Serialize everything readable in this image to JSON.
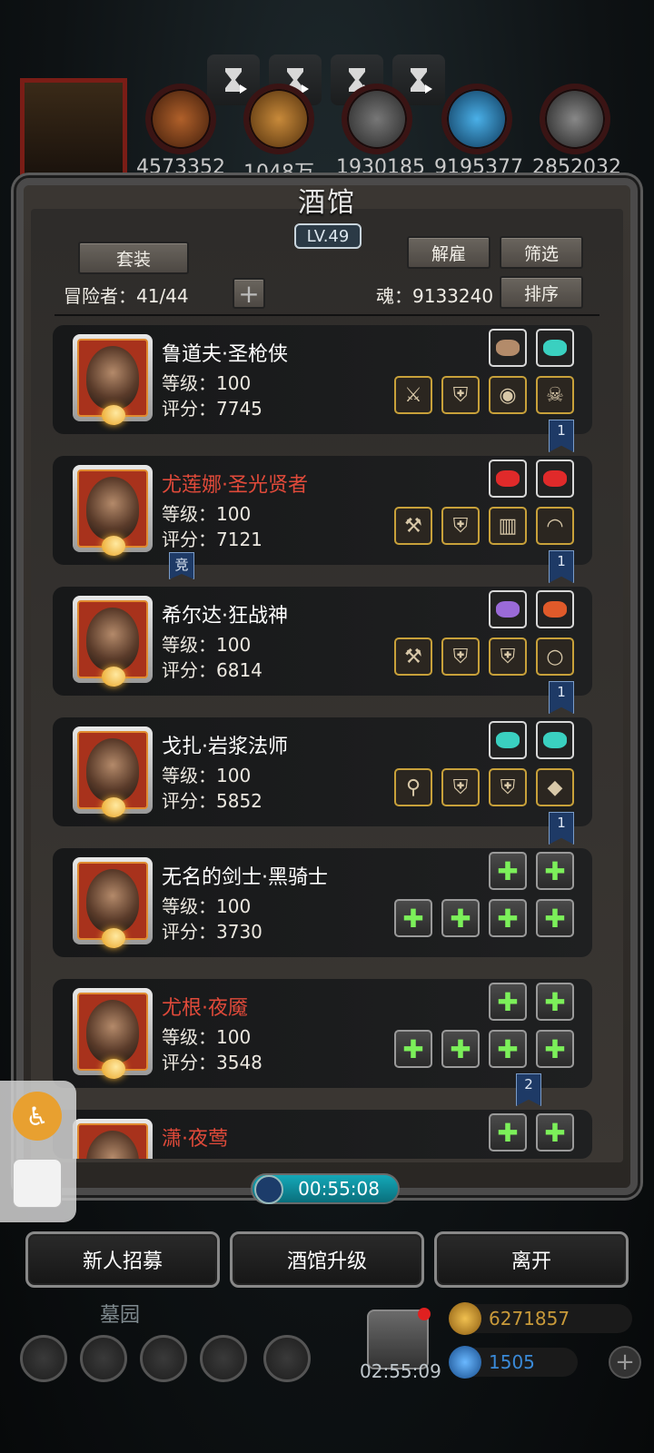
{
  "header": {
    "resources": [
      "4573352",
      "1048万",
      "1930185",
      "9195377",
      "2852032"
    ]
  },
  "panel": {
    "title": "酒馆",
    "level": "LV.49",
    "suit_button": "套装",
    "dismiss_button": "解雇",
    "filter_button": "筛选",
    "sort_button": "排序",
    "adventurers_label": "冒险者：41/44",
    "add_symbol": "+",
    "soul_label": "魂：9133240"
  },
  "heroes": [
    {
      "name": "鲁道夫·圣枪侠",
      "level": "等级：100",
      "score": "评分：7745",
      "red": false,
      "flag": "1",
      "extra_tag": ""
    },
    {
      "name": "尤莲娜·圣光贤者",
      "level": "等级：100",
      "score": "评分：7121",
      "red": true,
      "flag": "1",
      "extra_tag": "竞"
    },
    {
      "name": "希尔达·狂战神",
      "level": "等级：100",
      "score": "评分：6814",
      "red": false,
      "flag": "1",
      "extra_tag": ""
    },
    {
      "name": "戈扎·岩浆法师",
      "level": "等级：100",
      "score": "评分：5852",
      "red": false,
      "flag": "1",
      "extra_tag": ""
    },
    {
      "name": "无名的剑士·黑骑士",
      "level": "等级：100",
      "score": "评分：3730",
      "red": false,
      "flag": "",
      "extra_tag": ""
    },
    {
      "name": "尤根·夜魇",
      "level": "等级：100",
      "score": "评分：3548",
      "red": true,
      "flag": "2",
      "extra_tag": ""
    },
    {
      "name": "潇·夜莺",
      "level": "",
      "score": "",
      "red": true,
      "flag": "",
      "extra_tag": ""
    }
  ],
  "timer": "00:55:08",
  "actions": {
    "recruit": "新人招募",
    "upgrade": "酒馆升级",
    "leave": "离开"
  },
  "bottom": {
    "graveyard_label": "墓园",
    "gift_timer": "02:55:09",
    "gold": "6271857",
    "gems": "1505",
    "plus_symbol": "+"
  },
  "colors": {
    "red_name": "#e04a3a",
    "accent_teal": "#14a8b8",
    "frame_red": "#a8321c"
  }
}
